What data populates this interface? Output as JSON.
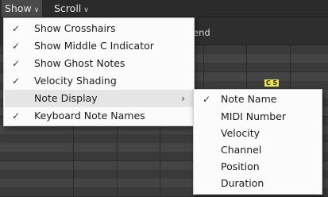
{
  "menubar": {
    "show_label": "Show",
    "scroll_label": "Scroll",
    "caret": "∨"
  },
  "background": {
    "legend_text": "end",
    "note_label": "C 5"
  },
  "show_menu": {
    "items": [
      {
        "label": "Show Crosshairs",
        "checked": "✓"
      },
      {
        "label": "Show Middle C Indicator",
        "checked": "✓"
      },
      {
        "label": "Show Ghost Notes",
        "checked": "✓"
      },
      {
        "label": "Velocity Shading",
        "checked": "✓"
      },
      {
        "label": "Note Display",
        "checked": "",
        "submenu_arrow": "›"
      },
      {
        "label": "Keyboard Note Names",
        "checked": "✓"
      }
    ]
  },
  "note_display_menu": {
    "items": [
      {
        "label": "Note Name",
        "checked": "✓"
      },
      {
        "label": "MIDI Number",
        "checked": ""
      },
      {
        "label": "Velocity",
        "checked": ""
      },
      {
        "label": "Channel",
        "checked": ""
      },
      {
        "label": "Position",
        "checked": ""
      },
      {
        "label": "Duration",
        "checked": ""
      }
    ]
  },
  "colors": {
    "menu_bg": "#fbfbfb",
    "highlight": "#e5e5e5",
    "note_yellow": "#e8e34b",
    "dark_bg": "#2b2b2b"
  }
}
